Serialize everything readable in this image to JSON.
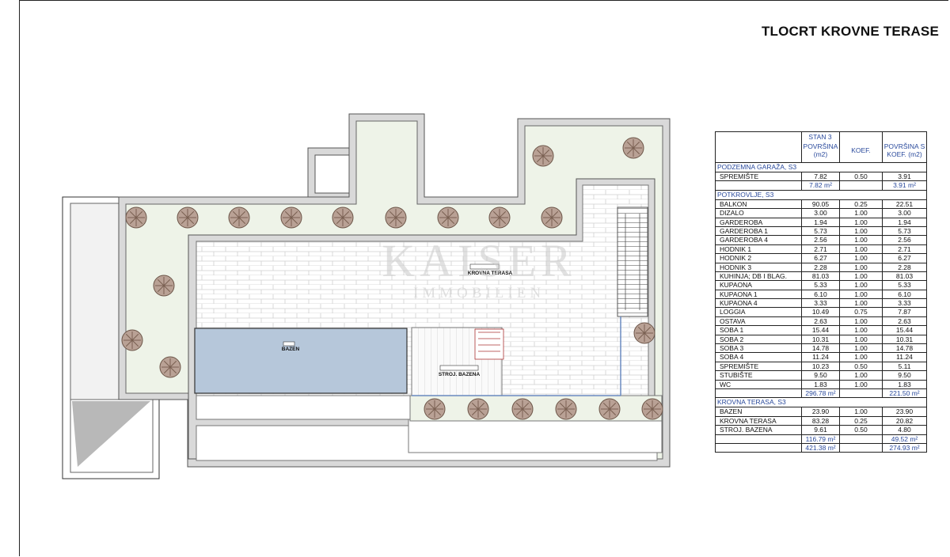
{
  "title": "TLOCRT KROVNE TERASE",
  "watermark": {
    "brand": "KAISER",
    "sub": "IMMOBILIEN"
  },
  "plan_labels": {
    "krovna_terasa": "KROVNA TERASA",
    "bazen": "BAZEN",
    "stroj_bazena": "STROJ. BAZENA"
  },
  "table": {
    "stan": "STAN 3",
    "headers": [
      "POVRŠINA",
      "(m2)",
      "KOEF.",
      "POVRŠINA S",
      "KOEF. (m2)"
    ],
    "sections": [
      {
        "name": "PODZEMNA GARAŽA, S3",
        "rows": [
          {
            "name": "SPREMIŠTE",
            "area": "7.82",
            "koef": "0.50",
            "weighted": "3.91"
          }
        ],
        "total_area": "7.82 m²",
        "total_weighted": "3.91 m²"
      },
      {
        "name": "POTKROVLJE, S3",
        "rows": [
          {
            "name": "BALKON",
            "area": "90.05",
            "koef": "0.25",
            "weighted": "22.51"
          },
          {
            "name": "DIZALO",
            "area": "3.00",
            "koef": "1.00",
            "weighted": "3.00"
          },
          {
            "name": "GARDEROBA",
            "area": "1.94",
            "koef": "1.00",
            "weighted": "1.94"
          },
          {
            "name": "GARDEROBA 1",
            "area": "5.73",
            "koef": "1.00",
            "weighted": "5.73"
          },
          {
            "name": "GARDEROBA 4",
            "area": "2.56",
            "koef": "1.00",
            "weighted": "2.56"
          },
          {
            "name": "HODNIK 1",
            "area": "2.71",
            "koef": "1.00",
            "weighted": "2.71"
          },
          {
            "name": "HODNIK 2",
            "area": "6.27",
            "koef": "1.00",
            "weighted": "6.27"
          },
          {
            "name": "HODNIK 3",
            "area": "2.28",
            "koef": "1.00",
            "weighted": "2.28"
          },
          {
            "name": "KUHINJA; DB I BLAG.",
            "area": "81.03",
            "koef": "1.00",
            "weighted": "81.03"
          },
          {
            "name": "KUPAONA",
            "area": "5.33",
            "koef": "1.00",
            "weighted": "5.33"
          },
          {
            "name": "KUPAONA 1",
            "area": "6.10",
            "koef": "1.00",
            "weighted": "6.10"
          },
          {
            "name": "KUPAONA 4",
            "area": "3.33",
            "koef": "1.00",
            "weighted": "3.33"
          },
          {
            "name": "LOGGIA",
            "area": "10.49",
            "koef": "0.75",
            "weighted": "7.87"
          },
          {
            "name": "OSTAVA",
            "area": "2.63",
            "koef": "1.00",
            "weighted": "2.63"
          },
          {
            "name": "SOBA 1",
            "area": "15.44",
            "koef": "1.00",
            "weighted": "15.44"
          },
          {
            "name": "SOBA 2",
            "area": "10.31",
            "koef": "1.00",
            "weighted": "10.31"
          },
          {
            "name": "SOBA 3",
            "area": "14.78",
            "koef": "1.00",
            "weighted": "14.78"
          },
          {
            "name": "SOBA 4",
            "area": "11.24",
            "koef": "1.00",
            "weighted": "11.24"
          },
          {
            "name": "SPREMIŠTE",
            "area": "10.23",
            "koef": "0.50",
            "weighted": "5.11"
          },
          {
            "name": "STUBIŠTE",
            "area": "9.50",
            "koef": "1.00",
            "weighted": "9.50"
          },
          {
            "name": "WC",
            "area": "1.83",
            "koef": "1.00",
            "weighted": "1.83"
          }
        ],
        "total_area": "296.78 m²",
        "total_weighted": "221.50 m²"
      },
      {
        "name": "KROVNA TERASA, S3",
        "rows": [
          {
            "name": "BAZEN",
            "area": "23.90",
            "koef": "1.00",
            "weighted": "23.90"
          },
          {
            "name": "KROVNA TERASA",
            "area": "83.28",
            "koef": "0.25",
            "weighted": "20.82"
          },
          {
            "name": "STROJ. BAZENA",
            "area": "9.61",
            "koef": "0.50",
            "weighted": "4.80"
          }
        ],
        "total_area": "116.79 m²",
        "total_weighted": "49.52 m²"
      }
    ],
    "grand_total_area": "421.38 m²",
    "grand_total_weighted": "274.93 m²"
  },
  "colors": {
    "garden": "#eef3e8",
    "pool": "#b6c7da",
    "wall": "#d9d9d9",
    "table_blue": "#2a4a9c"
  }
}
